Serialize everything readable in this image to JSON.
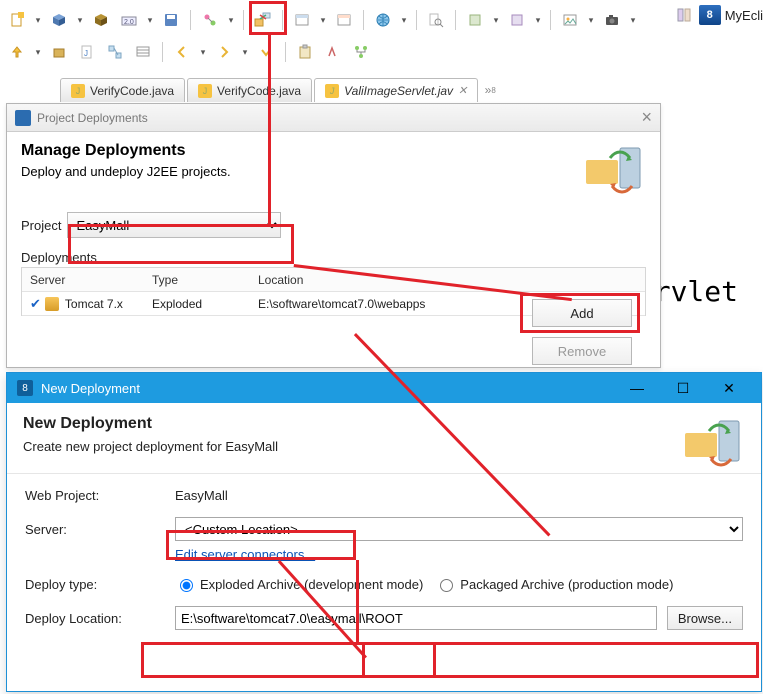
{
  "app": {
    "name": "MyEcli"
  },
  "tabs": [
    {
      "label": "VerifyCode.java",
      "active": false,
      "closable": false
    },
    {
      "label": "VerifyCode.java",
      "active": false,
      "closable": false
    },
    {
      "label": "ValiImageServlet.jav",
      "active": true,
      "closable": true
    }
  ],
  "background_code": "Servlet",
  "dlg1": {
    "title": "Project Deployments",
    "heading": "Manage Deployments",
    "sub": "Deploy and undeploy J2EE projects.",
    "project_label": "Project",
    "project_value": "EasyMall",
    "deployments_label": "Deployments",
    "columns": {
      "server": "Server",
      "type": "Type",
      "location": "Location"
    },
    "rows": [
      {
        "server": "Tomcat  7.x",
        "type": "Exploded",
        "location": "E:\\software\\tomcat7.0\\webapps"
      }
    ],
    "buttons": {
      "add": "Add",
      "remove": "Remove"
    }
  },
  "dlg2": {
    "title": "New Deployment",
    "heading": "New Deployment",
    "sub": "Create new project deployment for EasyMall",
    "webproject_label": "Web Project:",
    "webproject_value": "EasyMall",
    "server_label": "Server:",
    "server_value": "<Custom Location>",
    "edit_connectors": "Edit server connectors...",
    "deploytype_label": "Deploy type:",
    "radio_exploded": "Exploded Archive (development mode)",
    "radio_packaged": "Packaged Archive (production mode)",
    "deployloc_label": "Deploy Location:",
    "deployloc_value": "E:\\software\\tomcat7.0\\easymall\\ROOT",
    "browse": "Browse..."
  },
  "icons": {
    "toolbar1": [
      "new-doc",
      "box-plus",
      "box-alt",
      "box-100",
      "disk",
      "navigator-graph",
      "deploy-project",
      "ext-browser",
      "ext-browser-2",
      "globe",
      "search",
      "tool-a",
      "tool-b",
      "screenshot",
      "camera"
    ],
    "toolbar2": [
      "up-arrow",
      "pkg",
      "j-file",
      "struct",
      "bookmarks",
      "back",
      "fwd",
      "up",
      "paste",
      "marker",
      "tree"
    ]
  }
}
